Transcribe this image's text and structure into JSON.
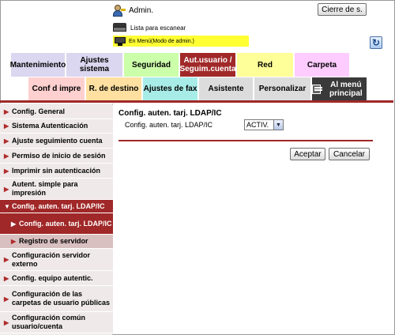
{
  "header": {
    "user_label": "Admin.",
    "logout_label": "Cierre de s.",
    "scan_list_label": "Lista para escanear",
    "mode_label": "En Menú(Modo de admin.)"
  },
  "top_tabs": [
    {
      "label": "Mantenimiento",
      "color": "#dcd7f0"
    },
    {
      "label": "Ajustes sistema",
      "color": "#dcd7f0"
    },
    {
      "label": "Seguridad",
      "color": "#ccffaa"
    },
    {
      "label": "Aut.usuario / Seguim.cuenta",
      "color": "#a02828"
    },
    {
      "label": "Red",
      "color": "#ffff99"
    },
    {
      "label": "Carpeta",
      "color": "#ffccff"
    }
  ],
  "sub_tabs": [
    {
      "label": "Conf d impre",
      "color": "#ffd0d0"
    },
    {
      "label": "R. de destino",
      "color": "#ffe0a0"
    },
    {
      "label": "Ajustes de fax",
      "color": "#a8ece8"
    },
    {
      "label": "Asistente",
      "color": "#dcdcdc"
    },
    {
      "label": "Personalizar",
      "color": "#dcdcdc"
    },
    {
      "label": "Al menú principal",
      "color": "#3a3a3a"
    }
  ],
  "sidebar": {
    "items": [
      {
        "label": "Config. General"
      },
      {
        "label": "Sistema Autenticación"
      },
      {
        "label": "Ajuste seguimiento cuenta"
      },
      {
        "label": "Permiso de inicio de sesión"
      },
      {
        "label": "Imprimir sin autenticación"
      },
      {
        "label": "Autent. simple para impresión"
      },
      {
        "label": "Config. auten. tarj. LDAP/IC"
      },
      {
        "label": "Config. auten. tarj. LDAP/IC"
      },
      {
        "label": "Registro de servidor"
      },
      {
        "label": "Configuración servidor externo"
      },
      {
        "label": "Config. equipo autentic."
      },
      {
        "label": "Configuración de las carpetas de usuario públicas"
      },
      {
        "label": "Configuración común usuario/cuenta"
      }
    ]
  },
  "content": {
    "title": "Config. auten. tarj. LDAP/IC",
    "field_label": "Config. auten. tarj. LDAP/IC",
    "select_value": "ACTIV.",
    "ok_label": "Aceptar",
    "cancel_label": "Cancelar"
  },
  "colors": {
    "accent": "#a02828",
    "mode_banner": "#ffff33"
  },
  "icons": {
    "user": "admin-user-icon",
    "scan": "scanner-icon",
    "mode": "monitor-icon",
    "refresh": "refresh-icon",
    "menu": "menu-icon"
  }
}
